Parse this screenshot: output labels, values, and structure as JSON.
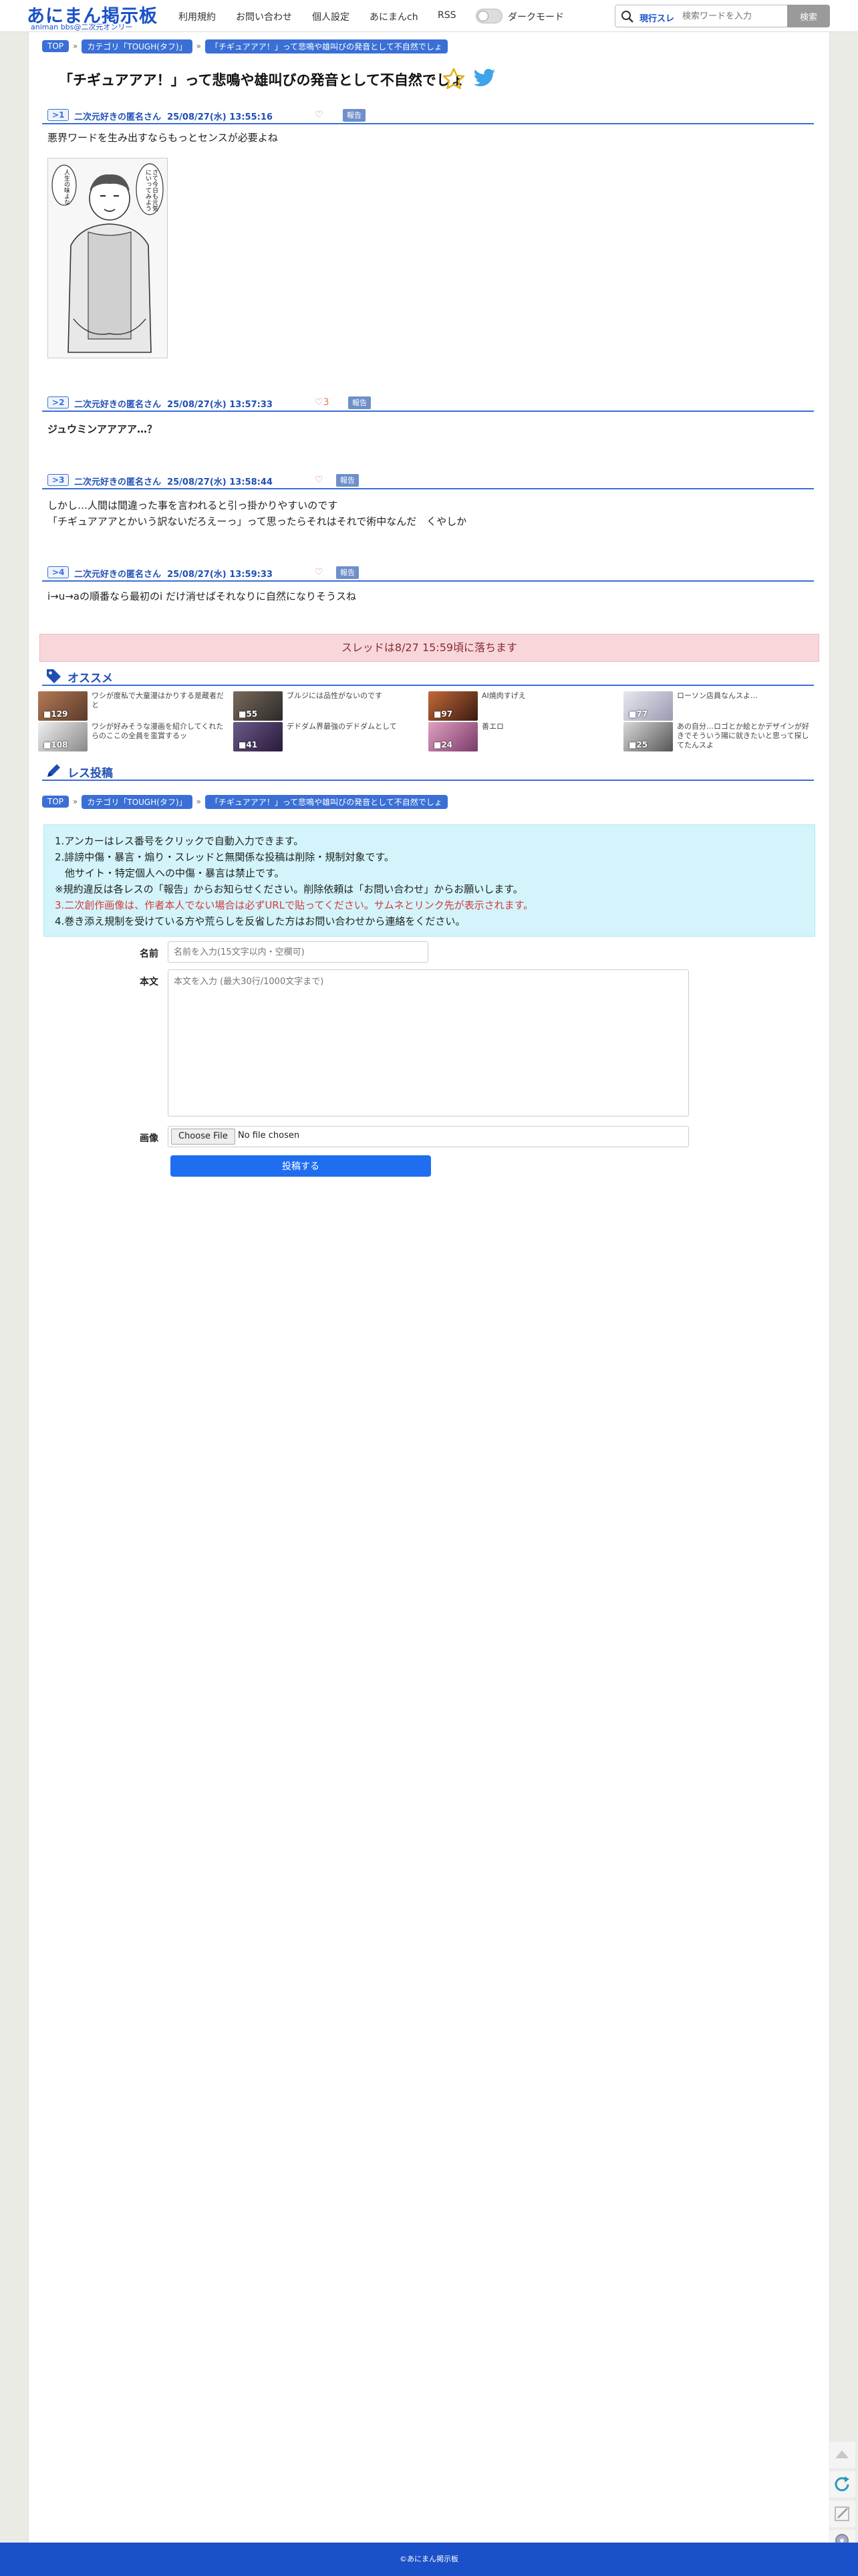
{
  "header": {
    "logo_main": "あにまん掲示板",
    "logo_sub": "animan bbs@二次元オンリー",
    "nav": [
      "利用規約",
      "お問い合わせ",
      "個人設定",
      "あにまんch",
      "RSS"
    ],
    "dark_mode_label": "ダークモード",
    "search_scope": "現行スレ",
    "search_placeholder": "検索ワードを入力",
    "search_button": "検索"
  },
  "breadcrumb": [
    "TOP",
    "カテゴリ「TOUGH(タフ)」",
    "「チギュアアア！」って悲鳴や雄叫びの発音として不自然でしょ"
  ],
  "thread": {
    "title": "「チギュアアア！」って悲鳴や雄叫びの発音として不自然でしょ",
    "posts": [
      {
        "num": "1",
        "name": "二次元好きの匿名さん",
        "date": "25/08/27(水) 13:55:16",
        "likes": "",
        "report": "報告",
        "body": [
          "悪界ワードを生み出すならもっとセンスが必要よね"
        ]
      },
      {
        "num": "2",
        "name": "二次元好きの匿名さん",
        "date": "25/08/27(水) 13:57:33",
        "likes": "3",
        "report": "報告",
        "body": [
          "ジュウミンアアアア…？"
        ]
      },
      {
        "num": "3",
        "name": "二次元好きの匿名さん",
        "date": "25/08/27(水) 13:58:44",
        "likes": "",
        "report": "報告",
        "body": [
          "しかし…人間は間違った事を言われると引っ掛かりやすいのです",
          "「チギュアアアとかいう訳ないだろえーっ」って思ったらそれはそれで術中なんだ　くやしか"
        ]
      },
      {
        "num": "4",
        "name": "二次元好きの匿名さん",
        "date": "25/08/27(水) 13:59:33",
        "likes": "",
        "report": "報告",
        "body": [
          "i→u→aの順番なら最初のi だけ消せばそれなりに自然になりそうスね"
        ]
      }
    ],
    "manga_bubble_1": "人生の味よな",
    "manga_bubble_2": "さて今日も元気にいってみよう",
    "expire_notice": "スレッドは8/27 15:59頃に落ちます"
  },
  "recommend": {
    "title": "オススメ",
    "items": [
      {
        "count": "129",
        "title": "ワシが度私で大童漫はかりする是蔵者だと"
      },
      {
        "count": "55",
        "title": "ブルジには品性がないのです"
      },
      {
        "count": "97",
        "title": "AI焼肉すげえ"
      },
      {
        "count": "77",
        "title": "ローソン店員なんスよ…"
      },
      {
        "count": "108",
        "title": "ワシが好みそうな漫画を紹介してくれたらのここの全員を蛮賞するッ"
      },
      {
        "count": "41",
        "title": "デドダム界最強のデドダムとして"
      },
      {
        "count": "24",
        "title": "善エロ"
      },
      {
        "count": "25",
        "title": "あの自分…ロゴとか絵とかデザインが好きでそういう陽に就きたいと思って探してたんスよ"
      }
    ]
  },
  "post_form": {
    "title": "レス投稿",
    "rules": [
      "1.アンカーはレス番号をクリックで自動入力できます。",
      "2.誹謗中傷・暴言・煽り・スレッドと無関係な投稿は削除・規制対象です。",
      "　他サイト・特定個人への中傷・暴言は禁止です。",
      "※規約違反は各レスの「報告」からお知らせください。削除依頼は「お問い合わせ」からお願いします。",
      "3.二次創作画像は、作者本人でない場合は必ずURLで貼ってください。サムネとリンク先が表示されます。",
      "4.巻き添え規制を受けている方や荒らしを反省した方はお問い合わせから連絡をください。"
    ],
    "name_label": "名前",
    "name_placeholder": "名前を入力(15文字以内・空欄可)",
    "body_label": "本文",
    "body_placeholder": "本文を入力 (最大30行/1000文字まで)",
    "image_label": "画像",
    "file_button": "Choose File",
    "file_status": "No file chosen",
    "submit": "投稿する"
  },
  "footer": "©あにまん掲示板",
  "colors": {
    "accent": "#1a50c8",
    "crumb": "#3a6fd6",
    "alert_bg": "#f8d7da",
    "rules_bg": "#d2f4fa",
    "submit": "#1f6ef0"
  },
  "icons": [
    "search-icon",
    "star-icon",
    "twitter-bird-icon",
    "tag-icon",
    "pencil-icon",
    "heart-icon",
    "comment-icon",
    "up-arrow-icon",
    "reload-icon",
    "edit-icon",
    "gear-icon"
  ]
}
